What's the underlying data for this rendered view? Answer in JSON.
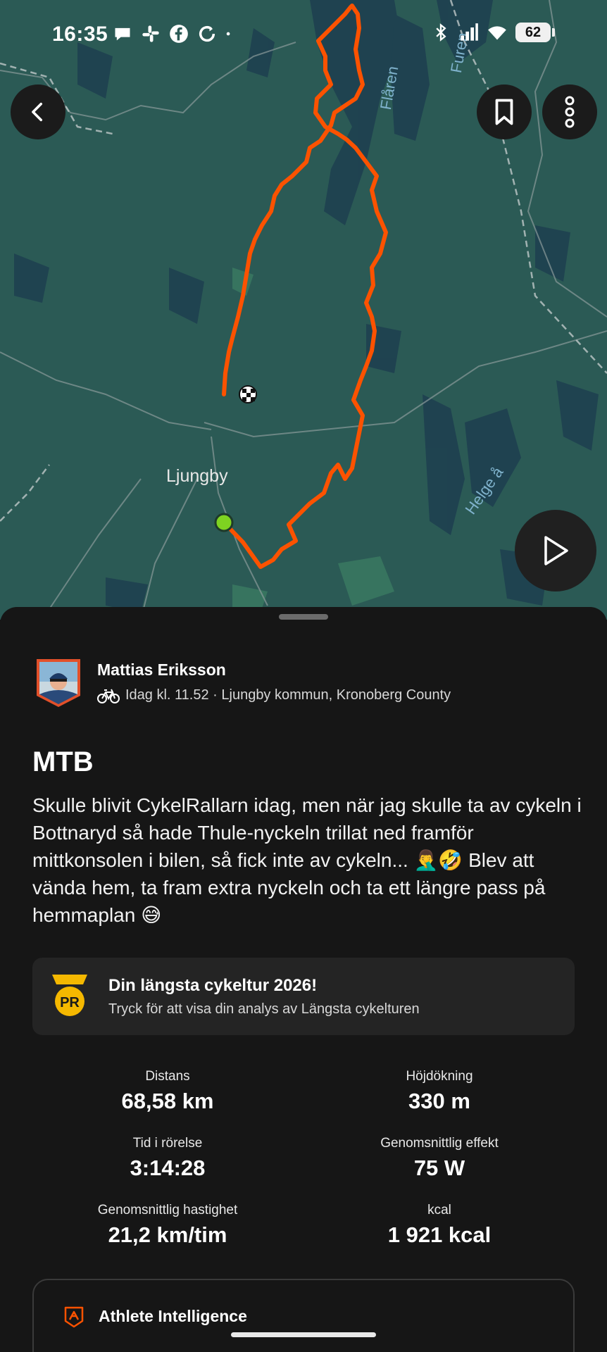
{
  "status_bar": {
    "time": "16:35",
    "battery": "62",
    "left_icons": [
      "chat-bubble-icon",
      "slack-icon",
      "facebook-icon",
      "sync-icon",
      "dot-icon"
    ],
    "right_icons": [
      "bluetooth-icon",
      "signal-icon",
      "wifi-icon",
      "battery-icon"
    ]
  },
  "map": {
    "labels": {
      "town": "Ljungby",
      "lake": "Flåren",
      "river1": "Furen",
      "river2": "Helge å"
    },
    "route_color": "#fc5200",
    "start_color": "#7ed321"
  },
  "header_buttons": {
    "back": "chevron-left-icon",
    "bookmark": "bookmark-icon",
    "more": "more-vertical-icon",
    "play": "play-icon"
  },
  "athlete": {
    "name": "Mattias Eriksson",
    "meta": "Idag kl. 11.52 · Ljungby kommun, Kronoberg County"
  },
  "activity": {
    "title": "MTB",
    "description": "Skulle blivit CykelRallarn idag, men när jag skulle ta av cykeln i Bottnaryd så hade Thule-nyckeln trillat ned framför mittkonsolen i bilen, så fick inte av cykeln... 🤦‍♂️🤣 Blev att vända hem, ta fram extra nyckeln och ta ett längre pass på hemmaplan 😅"
  },
  "pr": {
    "badge": "PR",
    "title": "Din längsta cykeltur 2026!",
    "subtitle": "Tryck för att visa din analys av Längsta cykelturen"
  },
  "stats": [
    {
      "label": "Distans",
      "value": "68,58 km"
    },
    {
      "label": "Höjdökning",
      "value": "330 m"
    },
    {
      "label": "Tid i rörelse",
      "value": "3:14:28"
    },
    {
      "label": "Genomsnittlig effekt",
      "value": "75 W"
    },
    {
      "label": "Genomsnittlig hastighet",
      "value": "21,2 km/tim"
    },
    {
      "label": "kcal",
      "value": "1 921 kcal"
    }
  ],
  "athlete_intelligence": {
    "title": "Athlete Intelligence"
  },
  "colors": {
    "background": "#161616",
    "card": "#242424",
    "accent": "#fc5200",
    "pr_gold": "#f5b800"
  }
}
